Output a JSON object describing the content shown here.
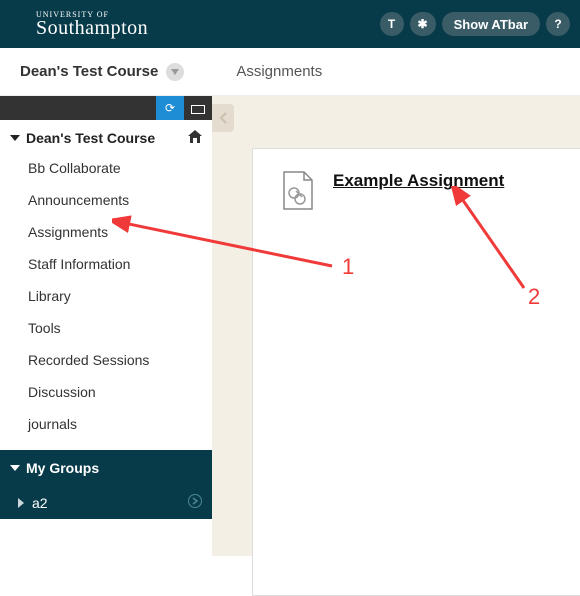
{
  "banner": {
    "logo_top": "UNIVERSITY OF",
    "logo_bottom": "Southampton",
    "btn_text": "T",
    "btn_star": "✱",
    "btn_show": "Show ATbar",
    "btn_help": "?"
  },
  "crumbs": {
    "course": "Dean's Test Course",
    "page": "Assignments"
  },
  "sidebar": {
    "toolbar": {
      "refresh": "⟳"
    },
    "course_head": "Dean's Test Course",
    "items": [
      {
        "label": "Bb Collaborate"
      },
      {
        "label": "Announcements"
      },
      {
        "label": "Assignments"
      },
      {
        "label": "Staff Information"
      },
      {
        "label": "Library"
      },
      {
        "label": "Tools"
      },
      {
        "label": "Recorded Sessions"
      },
      {
        "label": "Discussion"
      },
      {
        "label": "journals"
      }
    ],
    "groups_head": "My Groups",
    "groups": [
      {
        "label": "a2"
      }
    ]
  },
  "content": {
    "item_title": "Example Assignment"
  },
  "annotations": {
    "a1": "1",
    "a2": "2"
  }
}
